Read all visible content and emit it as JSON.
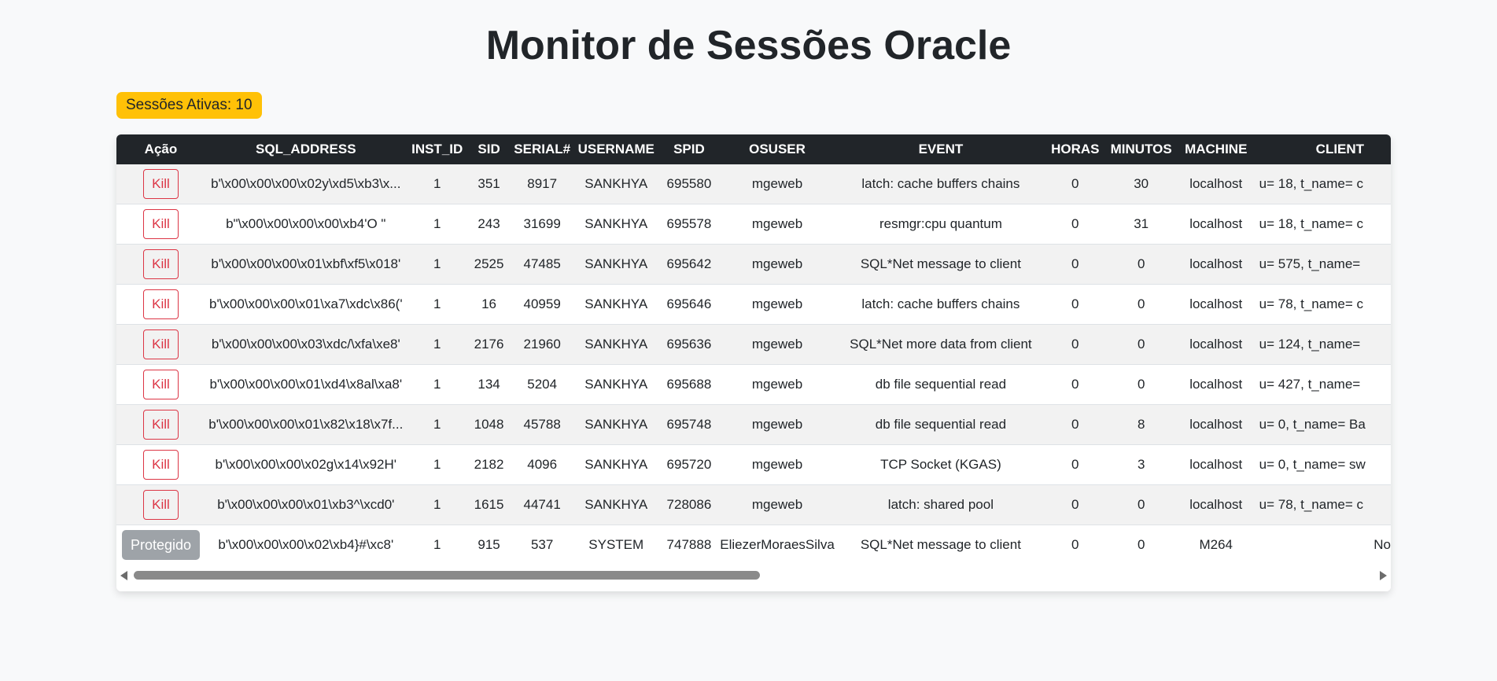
{
  "page": {
    "title": "Monitor de Sessões Oracle",
    "badge": "Sessões Ativas: 10"
  },
  "table": {
    "headers": [
      "Ação",
      "SQL_ADDRESS",
      "INST_ID",
      "SID",
      "SERIAL#",
      "USERNAME",
      "SPID",
      "OSUSER",
      "EVENT",
      "HORAS",
      "MINUTOS",
      "MACHINE",
      "CLIENT"
    ],
    "kill_label": "Kill",
    "protected_label": "Protegido",
    "rows": [
      {
        "action": "Kill",
        "sql_address": "b'\\x00\\x00\\x00\\x02y\\xd5\\xb3\\x...",
        "inst_id": "1",
        "sid": "351",
        "serial": "8917",
        "username": "SANKHYA",
        "spid": "695580",
        "osuser": "mgeweb",
        "event": "latch: cache buffers chains",
        "horas": "0",
        "minutos": "30",
        "machine": "localhost",
        "client": "u= 18, t_name= c"
      },
      {
        "action": "Kill",
        "sql_address": "b\"\\x00\\x00\\x00\\x00\\xb4'O \"",
        "inst_id": "1",
        "sid": "243",
        "serial": "31699",
        "username": "SANKHYA",
        "spid": "695578",
        "osuser": "mgeweb",
        "event": "resmgr:cpu quantum",
        "horas": "0",
        "minutos": "31",
        "machine": "localhost",
        "client": "u= 18, t_name= c"
      },
      {
        "action": "Kill",
        "sql_address": "b'\\x00\\x00\\x00\\x01\\xbf\\xf5\\x018'",
        "inst_id": "1",
        "sid": "2525",
        "serial": "47485",
        "username": "SANKHYA",
        "spid": "695642",
        "osuser": "mgeweb",
        "event": "SQL*Net message to client",
        "horas": "0",
        "minutos": "0",
        "machine": "localhost",
        "client": "u= 575, t_name="
      },
      {
        "action": "Kill",
        "sql_address": "b'\\x00\\x00\\x00\\x01\\xa7\\xdc\\x86('",
        "inst_id": "1",
        "sid": "16",
        "serial": "40959",
        "username": "SANKHYA",
        "spid": "695646",
        "osuser": "mgeweb",
        "event": "latch: cache buffers chains",
        "horas": "0",
        "minutos": "0",
        "machine": "localhost",
        "client": "u= 78, t_name= c"
      },
      {
        "action": "Kill",
        "sql_address": "b'\\x00\\x00\\x00\\x03\\xdc/\\xfa\\xe8'",
        "inst_id": "1",
        "sid": "2176",
        "serial": "21960",
        "username": "SANKHYA",
        "spid": "695636",
        "osuser": "mgeweb",
        "event": "SQL*Net more data from client",
        "horas": "0",
        "minutos": "0",
        "machine": "localhost",
        "client": "u= 124, t_name="
      },
      {
        "action": "Kill",
        "sql_address": "b'\\x00\\x00\\x00\\x01\\xd4\\x8al\\xa8'",
        "inst_id": "1",
        "sid": "134",
        "serial": "5204",
        "username": "SANKHYA",
        "spid": "695688",
        "osuser": "mgeweb",
        "event": "db file sequential read",
        "horas": "0",
        "minutos": "0",
        "machine": "localhost",
        "client": "u= 427, t_name="
      },
      {
        "action": "Kill",
        "sql_address": "b'\\x00\\x00\\x00\\x01\\x82\\x18\\x7f...",
        "inst_id": "1",
        "sid": "1048",
        "serial": "45788",
        "username": "SANKHYA",
        "spid": "695748",
        "osuser": "mgeweb",
        "event": "db file sequential read",
        "horas": "0",
        "minutos": "8",
        "machine": "localhost",
        "client": "u= 0, t_name= Ba"
      },
      {
        "action": "Kill",
        "sql_address": "b'\\x00\\x00\\x00\\x02g\\x14\\x92H'",
        "inst_id": "1",
        "sid": "2182",
        "serial": "4096",
        "username": "SANKHYA",
        "spid": "695720",
        "osuser": "mgeweb",
        "event": "TCP Socket (KGAS)",
        "horas": "0",
        "minutos": "3",
        "machine": "localhost",
        "client": "u= 0, t_name= sw"
      },
      {
        "action": "Kill",
        "sql_address": "b'\\x00\\x00\\x00\\x01\\xb3^\\xcd0'",
        "inst_id": "1",
        "sid": "1615",
        "serial": "44741",
        "username": "SANKHYA",
        "spid": "728086",
        "osuser": "mgeweb",
        "event": "latch: shared pool",
        "horas": "0",
        "minutos": "0",
        "machine": "localhost",
        "client": "u= 78, t_name= c"
      },
      {
        "action": "Protegido",
        "sql_address": "b'\\x00\\x00\\x00\\x02\\xb4}#\\xc8'",
        "inst_id": "1",
        "sid": "915",
        "serial": "537",
        "username": "SYSTEM",
        "spid": "747888",
        "osuser": "EliezerMoraesSilva",
        "event": "SQL*Net message to client",
        "horas": "0",
        "minutos": "0",
        "machine": "M264",
        "client": "No"
      }
    ]
  },
  "colors": {
    "badge": "#ffc107",
    "header_bg": "#212529",
    "kill": "#dc3545",
    "protected": "#9ea3a8"
  },
  "icons": {
    "scroll_left": "scroll-left-arrow-icon",
    "scroll_right": "scroll-right-arrow-icon"
  }
}
